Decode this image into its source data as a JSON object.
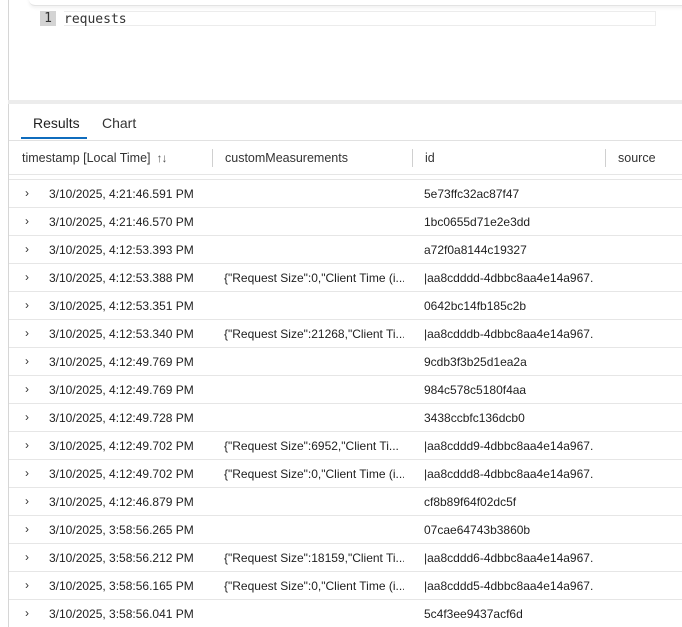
{
  "editor": {
    "line_number": "1",
    "query": "requests"
  },
  "tabs": [
    {
      "label": "Results",
      "active": true
    },
    {
      "label": "Chart",
      "active": false
    }
  ],
  "columns": {
    "timestamp": "timestamp [Local Time]",
    "sort_icon": "↑↓",
    "customMeasurements": "customMeasurements",
    "id": "id",
    "source": "source"
  },
  "row_expander_icon": "›",
  "rows": [
    {
      "timestamp": "3/10/2025, 4:21:46.591 PM",
      "customMeasurements": "",
      "id": "5e73ffc32ac87f47"
    },
    {
      "timestamp": "3/10/2025, 4:21:46.570 PM",
      "customMeasurements": "",
      "id": "1bc0655d71e2e3dd"
    },
    {
      "timestamp": "3/10/2025, 4:12:53.393 PM",
      "customMeasurements": "",
      "id": "a72f0a8144c19327"
    },
    {
      "timestamp": "3/10/2025, 4:12:53.388 PM",
      "customMeasurements": "{\"Request Size\":0,\"Client Time (i...",
      "id": "|aa8cdddd-4dbbc8aa4e14a967."
    },
    {
      "timestamp": "3/10/2025, 4:12:53.351 PM",
      "customMeasurements": "",
      "id": "0642bc14fb185c2b"
    },
    {
      "timestamp": "3/10/2025, 4:12:53.340 PM",
      "customMeasurements": "{\"Request Size\":21268,\"Client Ti...",
      "id": "|aa8cdddb-4dbbc8aa4e14a967."
    },
    {
      "timestamp": "3/10/2025, 4:12:49.769 PM",
      "customMeasurements": "",
      "id": "9cdb3f3b25d1ea2a"
    },
    {
      "timestamp": "3/10/2025, 4:12:49.769 PM",
      "customMeasurements": "",
      "id": "984c578c5180f4aa"
    },
    {
      "timestamp": "3/10/2025, 4:12:49.728 PM",
      "customMeasurements": "",
      "id": "3438ccbfc136dcb0"
    },
    {
      "timestamp": "3/10/2025, 4:12:49.702 PM",
      "customMeasurements": "{\"Request Size\":6952,\"Client Ti...",
      "id": "|aa8cddd9-4dbbc8aa4e14a967."
    },
    {
      "timestamp": "3/10/2025, 4:12:49.702 PM",
      "customMeasurements": "{\"Request Size\":0,\"Client Time (i...",
      "id": "|aa8cddd8-4dbbc8aa4e14a967."
    },
    {
      "timestamp": "3/10/2025, 4:12:46.879 PM",
      "customMeasurements": "",
      "id": "cf8b89f64f02dc5f"
    },
    {
      "timestamp": "3/10/2025, 3:58:56.265 PM",
      "customMeasurements": "",
      "id": "07cae64743b3860b"
    },
    {
      "timestamp": "3/10/2025, 3:58:56.212 PM",
      "customMeasurements": "{\"Request Size\":18159,\"Client Ti...",
      "id": "|aa8cddd6-4dbbc8aa4e14a967."
    },
    {
      "timestamp": "3/10/2025, 3:58:56.165 PM",
      "customMeasurements": "{\"Request Size\":0,\"Client Time (i...",
      "id": "|aa8cddd5-4dbbc8aa4e14a967."
    },
    {
      "timestamp": "3/10/2025, 3:58:56.041 PM",
      "customMeasurements": "",
      "id": "5c4f3ee9437acf6d"
    }
  ],
  "colors": {
    "accent": "#0f6cbd",
    "border": "#e6e6e6",
    "line_number_bg": "#d4d4d4"
  }
}
